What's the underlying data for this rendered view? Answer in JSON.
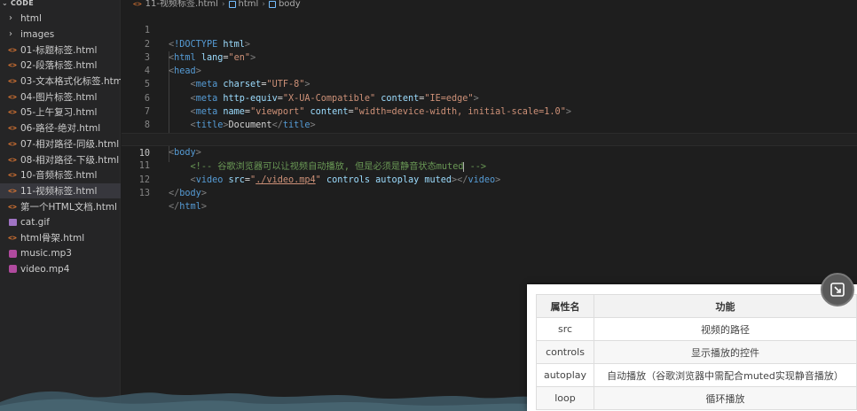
{
  "sidebar": {
    "header": "CODE",
    "items": [
      {
        "label": "html",
        "kind": "folder"
      },
      {
        "label": "images",
        "kind": "folder"
      },
      {
        "label": "01-标题标签.html",
        "kind": "html"
      },
      {
        "label": "02-段落标签.html",
        "kind": "html"
      },
      {
        "label": "03-文本格式化标签.html",
        "kind": "html"
      },
      {
        "label": "04-图片标签.html",
        "kind": "html"
      },
      {
        "label": "05-上午复习.html",
        "kind": "html"
      },
      {
        "label": "06-路径-绝对.html",
        "kind": "html"
      },
      {
        "label": "07-相对路径-同级.html",
        "kind": "html"
      },
      {
        "label": "08-相对路径-下级.html",
        "kind": "html"
      },
      {
        "label": "10-音频标签.html",
        "kind": "html"
      },
      {
        "label": "11-视频标签.html",
        "kind": "html",
        "selected": true
      },
      {
        "label": "第一个HTML文档.html",
        "kind": "html"
      },
      {
        "label": "cat.gif",
        "kind": "image"
      },
      {
        "label": "html骨架.html",
        "kind": "html"
      },
      {
        "label": "music.mp3",
        "kind": "media"
      },
      {
        "label": "video.mp4",
        "kind": "media"
      }
    ]
  },
  "breadcrumb": {
    "file": "11-视频标签.html",
    "crumb1": "html",
    "crumb2": "body"
  },
  "editor": {
    "line_numbers": [
      "1",
      "2",
      "3",
      "4",
      "5",
      "6",
      "7",
      "8",
      "9",
      "10",
      "11",
      "12",
      "13"
    ],
    "current_line": "10"
  },
  "code": {
    "l1_doctype": "<!DOCTYPE",
    "l1_html": " html",
    "l1_close": ">",
    "l10_comment_a": "<!-- 谷歌浏览器可以让视频自动播放, 但是必须是静音状态muted",
    "l10_comment_b": " -->",
    "l11_src": "./video.mp4",
    "l12_text": "Document"
  },
  "ref_table": {
    "headers": [
      "属性名",
      "功能"
    ],
    "rows": [
      [
        "src",
        "视频的路径"
      ],
      [
        "controls",
        "显示播放的控件"
      ],
      [
        "autoplay",
        "自动播放（谷歌浏览器中需配合muted实现静音播放）"
      ],
      [
        "loop",
        "循环播放"
      ]
    ]
  },
  "colors": {
    "editor_bg": "#1e1e1e",
    "sidebar_bg": "#252526",
    "tag": "#569cd6",
    "attr": "#9cdcfe",
    "string": "#ce9178",
    "comment": "#6a9955"
  }
}
